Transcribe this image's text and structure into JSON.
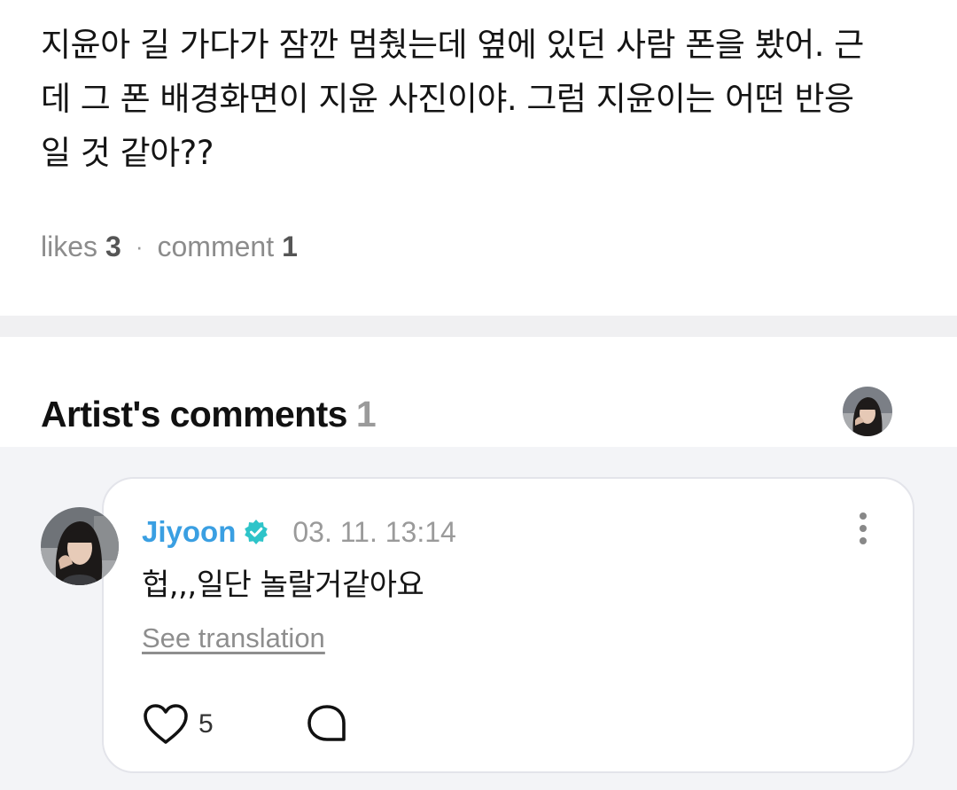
{
  "post": {
    "body": "지윤아 길 가다가 잠깐 멈췄는데 옆에 있던 사람 폰을 봤어. 근\n데 그 폰 배경화면이 지윤 사진이야. 그럼 지윤이는 어떤 반응\n일 것 같아??",
    "likes_label": "likes",
    "likes_count": "3",
    "separator": "·",
    "comment_label": "comment",
    "comment_count": "1"
  },
  "artist_comments": {
    "title": "Artist's comments",
    "count": "1"
  },
  "comment": {
    "author": "Jiyoon",
    "timestamp": "03. 11. 13:14",
    "text": "헙,,,일단 놀랄거같아요",
    "translation_link": "See translation",
    "like_count": "5"
  },
  "colors": {
    "accent": "#3a9fe2",
    "verified": "#2ec4c9",
    "muted": "#9a9a9a",
    "section_bg": "#f3f4f7"
  },
  "icons": {
    "verified": "verified-badge-icon",
    "more": "more-vertical-icon",
    "like": "heart-outline-icon",
    "reply": "chat-bubble-icon"
  }
}
